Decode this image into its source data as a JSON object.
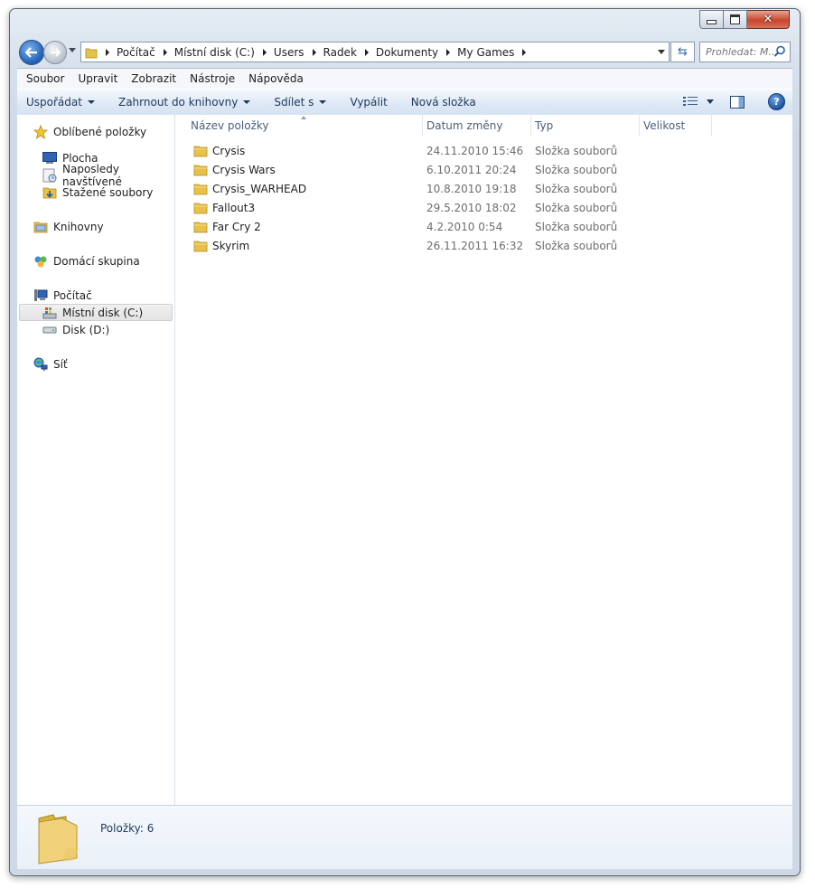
{
  "window": {
    "caption_buttons": [
      "minimize",
      "maximize",
      "close"
    ]
  },
  "address": {
    "crumbs": [
      "Počítač",
      "Místní disk (C:)",
      "Users",
      "Radek",
      "Dokumenty",
      "My Games"
    ]
  },
  "search": {
    "placeholder": "Prohledat: M..."
  },
  "menu": [
    "Soubor",
    "Upravit",
    "Zobrazit",
    "Nástroje",
    "Nápověda"
  ],
  "commands": {
    "organize": "Uspořádat",
    "include": "Zahrnout do knihovny",
    "share": "Sdílet s",
    "burn": "Vypálit",
    "new_folder": "Nová složka"
  },
  "navpane": {
    "favorites": "Oblíbené položky",
    "desktop": "Plocha",
    "recent": "Naposledy navštívené",
    "downloads": "Stažené soubory",
    "libraries": "Knihovny",
    "homegroup": "Domácí skupina",
    "computer": "Počítač",
    "drive_c": "Místní disk (C:)",
    "drive_d": "Disk (D:)",
    "network": "Síť"
  },
  "columns": {
    "name": "Název položky",
    "date": "Datum změny",
    "type": "Typ",
    "size": "Velikost"
  },
  "files": [
    {
      "name": "Crysis",
      "date": "24.11.2010 15:46",
      "type": "Složka souborů"
    },
    {
      "name": "Crysis Wars",
      "date": "6.10.2011 20:24",
      "type": "Složka souborů"
    },
    {
      "name": "Crysis_WARHEAD",
      "date": "10.8.2010 19:18",
      "type": "Složka souborů"
    },
    {
      "name": "Fallout3",
      "date": "29.5.2010 18:02",
      "type": "Složka souborů"
    },
    {
      "name": "Far Cry 2",
      "date": "4.2.2010 0:54",
      "type": "Složka souborů"
    },
    {
      "name": "Skyrim",
      "date": "26.11.2011 16:32",
      "type": "Složka souborů"
    }
  ],
  "details": {
    "count": "Položky: 6"
  }
}
